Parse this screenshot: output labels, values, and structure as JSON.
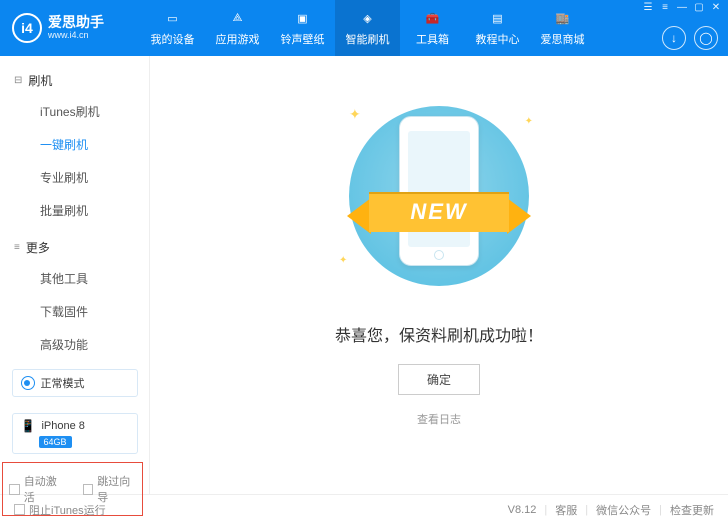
{
  "app": {
    "name": "爱思助手",
    "url": "www.i4.cn",
    "logo_text": "i4"
  },
  "window_controls": [
    "☰",
    "≡",
    "—",
    "▢",
    "✕"
  ],
  "nav": [
    {
      "label": "我的设备"
    },
    {
      "label": "应用游戏"
    },
    {
      "label": "铃声壁纸"
    },
    {
      "label": "智能刷机",
      "active": true
    },
    {
      "label": "工具箱"
    },
    {
      "label": "教程中心"
    },
    {
      "label": "爱思商城"
    }
  ],
  "header_buttons": {
    "download": "↓",
    "user": "◯"
  },
  "sidebar": {
    "section1": {
      "title": "刷机",
      "items": [
        "iTunes刷机",
        "一键刷机",
        "专业刷机",
        "批量刷机"
      ],
      "active_index": 1
    },
    "section2": {
      "title": "更多",
      "items": [
        "其他工具",
        "下载固件",
        "高级功能"
      ]
    },
    "mode": "正常模式",
    "device": {
      "name": "iPhone 8",
      "storage": "64GB"
    },
    "checkboxes": {
      "auto_activate": "自动激活",
      "skip_guide": "跳过向导"
    }
  },
  "content": {
    "ribbon_text": "NEW",
    "success_message": "恭喜您，保资料刷机成功啦！",
    "confirm": "确定",
    "view_log": "查看日志"
  },
  "statusbar": {
    "block_itunes": "阻止iTunes运行",
    "version": "V8.12",
    "support": "客服",
    "wechat": "微信公众号",
    "check_update": "检查更新"
  }
}
